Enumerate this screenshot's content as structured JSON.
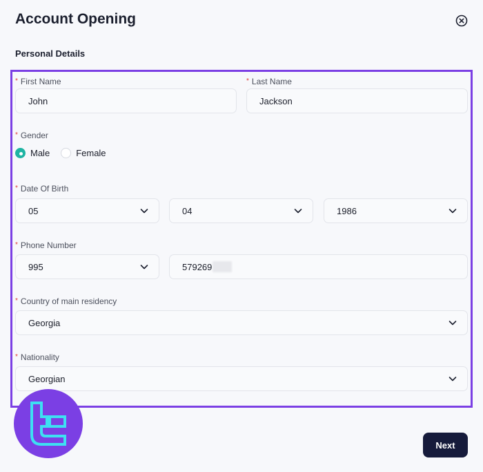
{
  "header": {
    "title": "Account Opening",
    "close_icon": "close-circle-icon"
  },
  "section": {
    "title": "Personal Details"
  },
  "form": {
    "first_name": {
      "label": "First Name",
      "value": "John"
    },
    "last_name": {
      "label": "Last Name",
      "value": "Jackson"
    },
    "gender": {
      "label": "Gender",
      "options": [
        "Male",
        "Female"
      ],
      "selected": "Male"
    },
    "date_of_birth": {
      "label": "Date Of Birth",
      "day": "05",
      "month": "04",
      "year": "1986"
    },
    "phone_number": {
      "label": "Phone Number",
      "code": "995",
      "number": "579269"
    },
    "country": {
      "label": "Country of main residency",
      "value": "Georgia"
    },
    "nationality": {
      "label": "Nationality",
      "value": "Georgian"
    },
    "required_marker": "*"
  },
  "footer": {
    "next_label": "Next"
  },
  "colors": {
    "highlight": "#7b3fe4",
    "radio_selected": "#1fb4a3",
    "next_button": "#161b3b",
    "required": "#e03a3a"
  }
}
